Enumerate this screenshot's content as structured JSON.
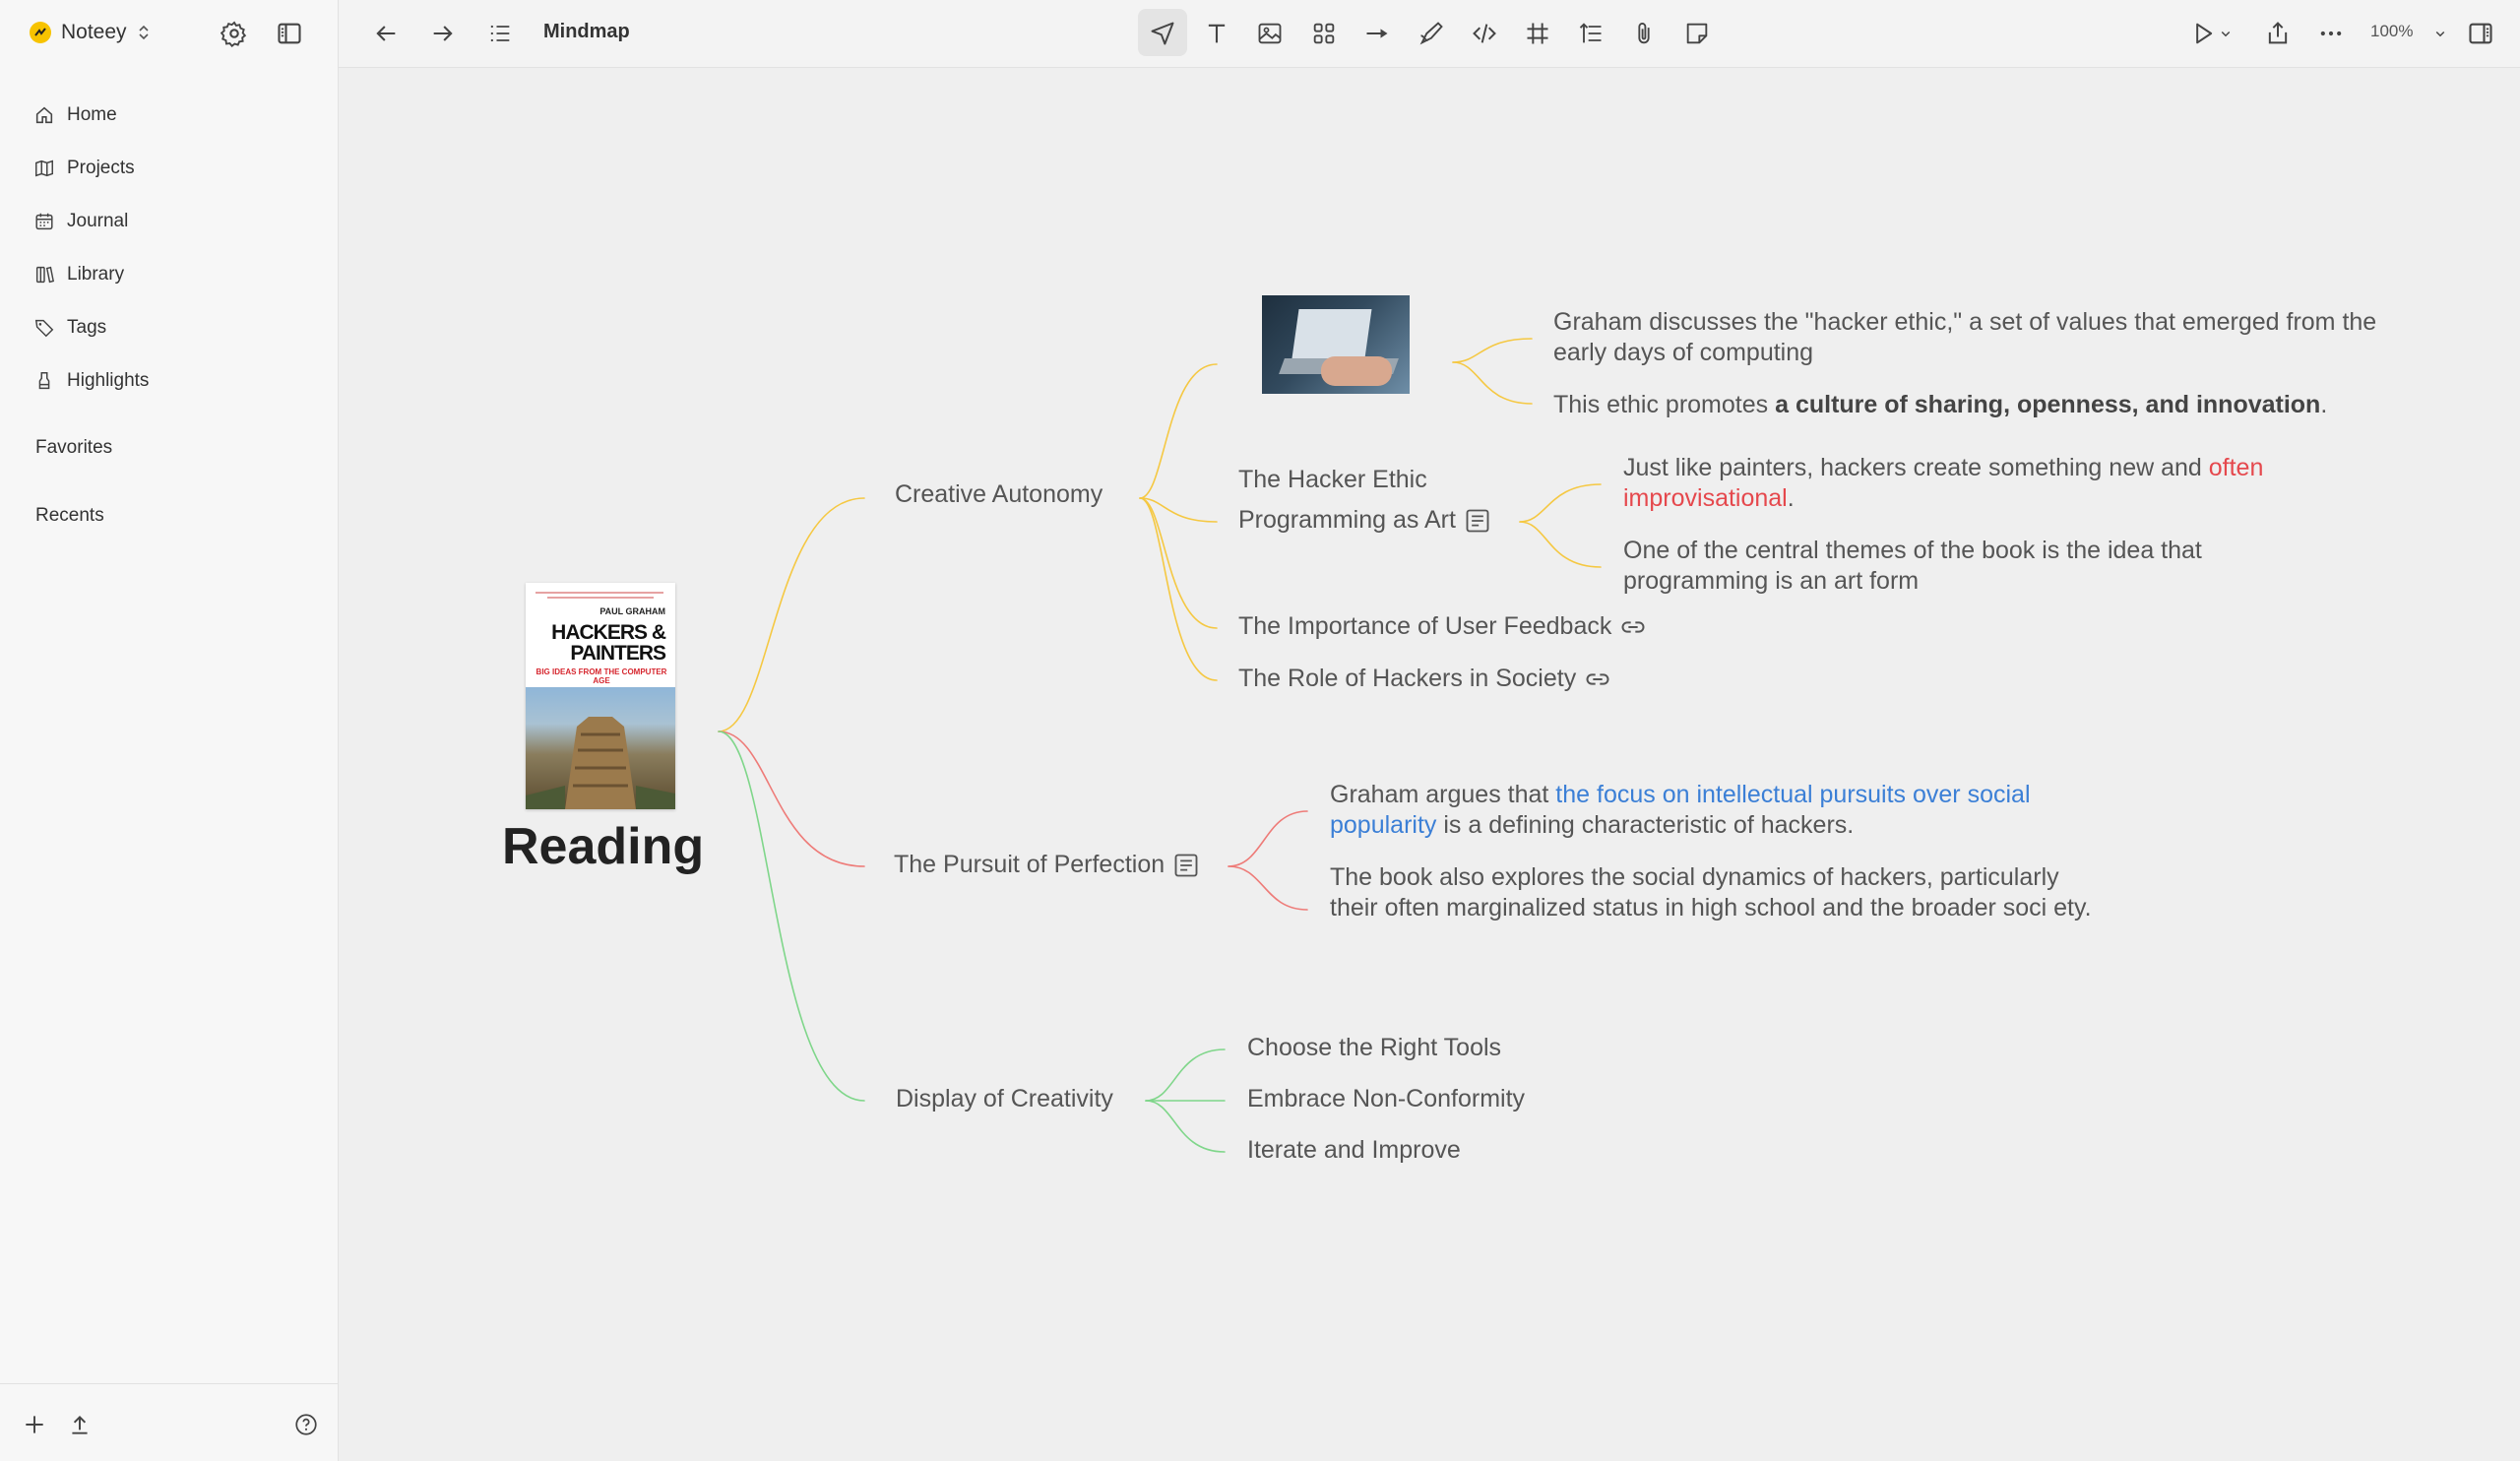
{
  "app": {
    "name": "Noteey"
  },
  "sidebar": {
    "items": [
      {
        "label": "Home",
        "icon": "home-icon"
      },
      {
        "label": "Projects",
        "icon": "map-icon"
      },
      {
        "label": "Journal",
        "icon": "calendar-icon"
      },
      {
        "label": "Library",
        "icon": "library-icon"
      },
      {
        "label": "Tags",
        "icon": "tag-icon"
      },
      {
        "label": "Highlights",
        "icon": "highlighter-icon"
      }
    ],
    "sections": {
      "favorites": "Favorites",
      "recents": "Recents"
    }
  },
  "topbar": {
    "title": "Mindmap",
    "zoom": "100%"
  },
  "colors": {
    "branch_creative": "#f5c842",
    "branch_pursuit": "#ee7b78",
    "branch_display": "#7fd68a",
    "red_text": "#e5484d",
    "blue_text": "#3b7fd6"
  },
  "mindmap": {
    "root": {
      "label": "Reading"
    },
    "book": {
      "author": "PAUL GRAHAM",
      "title_line1": "HACKERS &",
      "title_line2": "PAINTERS",
      "subtitle": "BIG IDEAS FROM THE COMPUTER AGE"
    },
    "creative": {
      "label": "Creative Autonomy",
      "hacker_ethic": {
        "label": "The Hacker Ethic",
        "note1": "Graham discusses the \"hacker ethic,\" a set of values that emerged from the early days of computing",
        "note2_pre": "This ethic promotes ",
        "note2_bold": "a culture of sharing, openness, and innovation",
        "note2_post": "."
      },
      "programming_art": {
        "label": "Programming as Art",
        "note1_pre": "Just like painters, hackers create something new and ",
        "note1_red": "often improvisational",
        "note1_post": ".",
        "note2": "One of the central themes of the book is the idea that programming is an art form"
      },
      "user_feedback": {
        "label": "The Importance of User Feedback"
      },
      "role_hackers": {
        "label": "The Role of Hackers in Society"
      }
    },
    "pursuit": {
      "label": "The Pursuit of Perfection",
      "note1_pre": "Graham argues that ",
      "note1_blue": "the focus on intellectual pursuits over social popularity",
      "note1_post": " is a defining characteristic of hackers.",
      "note2": "The book also explores the social dynamics of hackers, particularly their often marginalized status in high school and the broader soci ety."
    },
    "display": {
      "label": "Display of Creativity",
      "children": [
        "Choose the Right Tools",
        "Embrace Non-Conformity",
        "Iterate and Improve"
      ]
    }
  }
}
